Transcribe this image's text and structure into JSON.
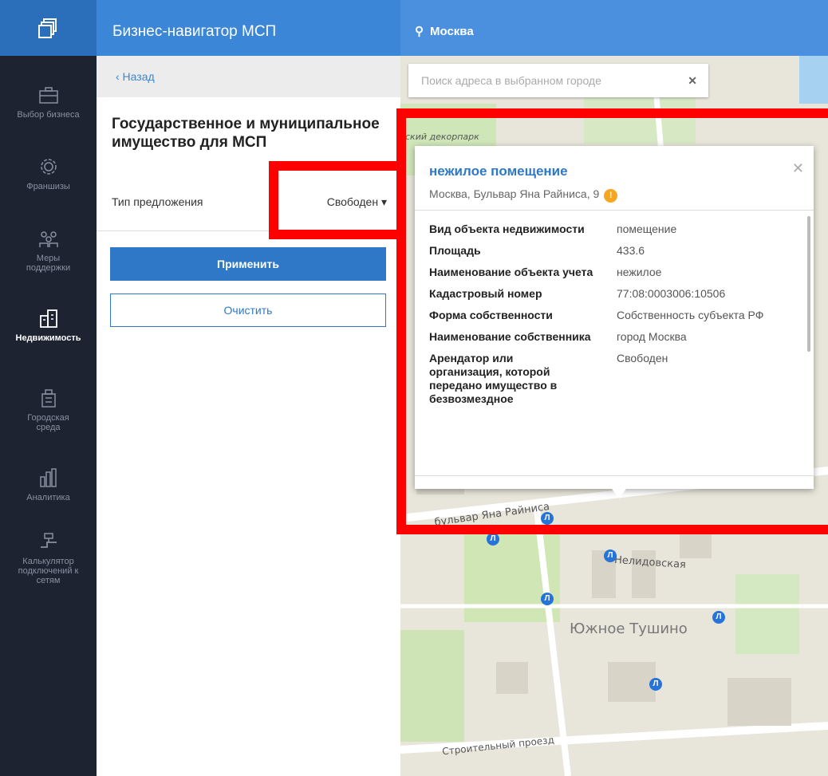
{
  "header": {
    "app_title": "Бизнес-навигатор МСП",
    "city": "Москва"
  },
  "sidebar": {
    "items": [
      {
        "label": "Выбор бизнеса",
        "icon": "briefcase-icon"
      },
      {
        "label": "Франшизы",
        "icon": "franchise-gear-icon"
      },
      {
        "label": "Меры поддержки",
        "icon": "people-icon"
      },
      {
        "label": "Недвижимость",
        "icon": "building-icon",
        "active": true
      },
      {
        "label": "Городская среда",
        "icon": "city-icon"
      },
      {
        "label": "Аналитика",
        "icon": "chart-icon"
      },
      {
        "label": "Калькулятор подключений к сетям",
        "icon": "pipe-icon"
      }
    ]
  },
  "panel": {
    "back_label": "‹ Назад",
    "title": "Государственное и муниципальное имущество для МСП",
    "type_label": "Тип предложения",
    "type_value": "Свободен",
    "apply_label": "Применить",
    "clear_label": "Очистить"
  },
  "map": {
    "search_placeholder": "Поиск адреса в выбранном городе",
    "labels": {
      "boulevard": "бульвар Яна Райниса",
      "street": "Нелидовская",
      "district": "Южное Тушино",
      "proezd": "Строительный проезд",
      "decor": "ский декорпарк"
    }
  },
  "popup": {
    "title": "нежилое помещение",
    "address": "Москва, Бульвар Яна Райниса, 9",
    "rows": [
      {
        "key": "Вид объекта недвижимости",
        "value": "помещение"
      },
      {
        "key": "Площадь",
        "value": "433.6"
      },
      {
        "key": "Наименование объекта учета",
        "value": "нежилое"
      },
      {
        "key": "Кадастровый номер",
        "value": "77:08:0003006:10506"
      },
      {
        "key": "Форма собственности",
        "value": "Собственность субъекта РФ"
      },
      {
        "key": "Наименование собственника",
        "value": "город Москва"
      },
      {
        "key": "Арендатор или организация, которой передано имущество в безвозмездное",
        "value": "Свободен"
      }
    ]
  },
  "colors": {
    "accent": "#2f78c8",
    "rail": "#1e2332",
    "highlight": "#ff0000"
  }
}
